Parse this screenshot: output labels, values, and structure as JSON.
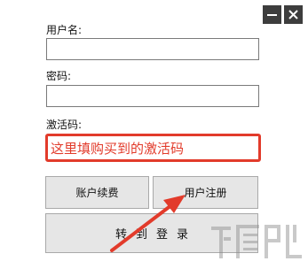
{
  "window": {
    "minimize_symbol": "—",
    "close_symbol": "✕"
  },
  "form": {
    "username_label": "用户名:",
    "password_label": "密码:",
    "activation_label": "激活码:",
    "activation_hint": "这里填购买到的激活码"
  },
  "buttons": {
    "renew_label": "账户续费",
    "register_label": "用户注册",
    "login_label": "转到登录"
  },
  "annotation": {
    "color": "#e23b2b",
    "arrow_icon": "red-arrow-icon"
  },
  "watermark": {
    "icon": "download-site-logo"
  }
}
